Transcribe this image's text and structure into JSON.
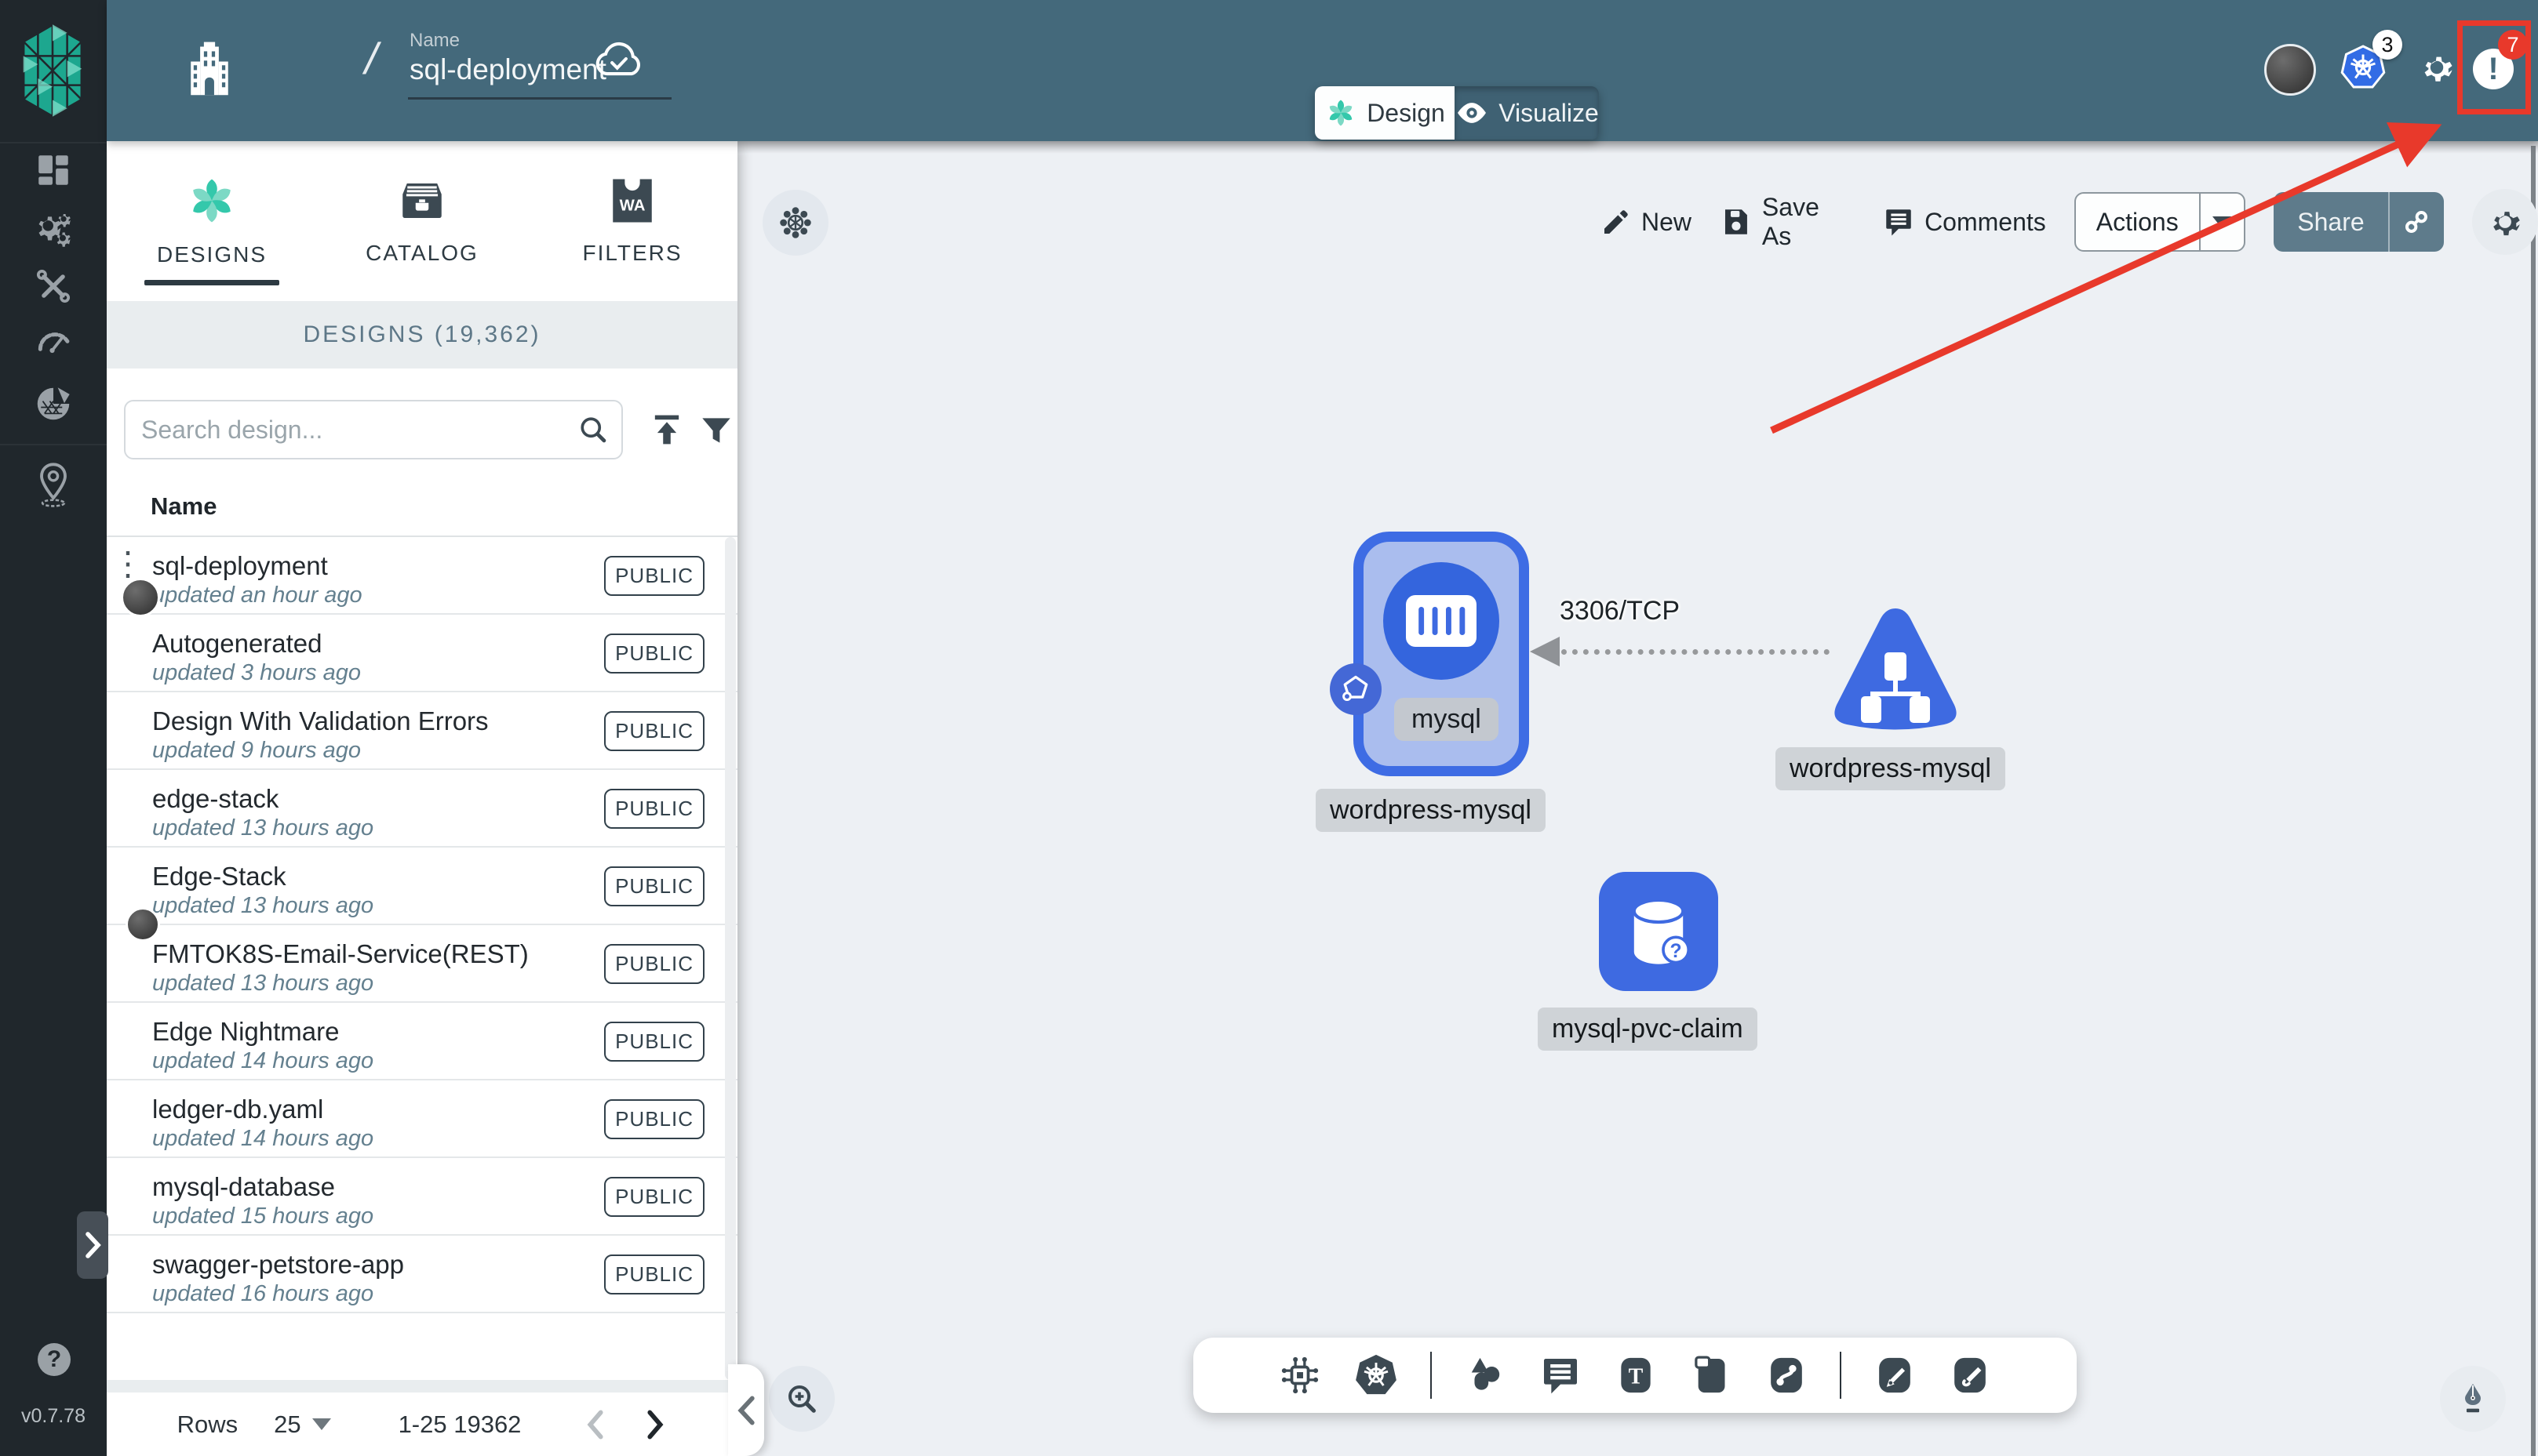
{
  "app": {
    "version": "v0.7.78",
    "help_glyph": "?",
    "notification_glyph": "!"
  },
  "header": {
    "name_label": "Name",
    "design_name": "sql-deployment",
    "breadcrumb_slash": "/",
    "kubernetes_context_count": "3",
    "notification_count": "7",
    "icons": [
      "organization-building-icon",
      "cloud-save-icon",
      "user-avatar",
      "kubernetes-icon",
      "gear-icon",
      "notification-icon"
    ]
  },
  "mode_tabs": {
    "design": "Design",
    "visualize": "Visualize"
  },
  "sidebar": {
    "icons": [
      "dashboard-icon",
      "lifecycle-gears-icon",
      "configuration-tools-icon",
      "performance-gauge-icon",
      "extensions-mesh-icon",
      "kanvas-pin-icon",
      "expand-chevron-icon",
      "help-icon"
    ]
  },
  "left_panel": {
    "tabs": [
      {
        "label": "DESIGNS"
      },
      {
        "label": "CATALOG"
      },
      {
        "label": "FILTERS"
      }
    ],
    "section_title": "DESIGNS (19,362)",
    "search_placeholder": "Search design...",
    "column_header": "Name",
    "rows": [
      {
        "name": "sql-deployment",
        "updated": "updated an hour ago",
        "visibility": "PUBLIC"
      },
      {
        "name": "Autogenerated",
        "updated": "updated 3 hours ago",
        "visibility": "PUBLIC"
      },
      {
        "name": "Design With Validation Errors",
        "updated": "updated 9 hours ago",
        "visibility": "PUBLIC"
      },
      {
        "name": "edge-stack",
        "updated": "updated 13 hours ago",
        "visibility": "PUBLIC"
      },
      {
        "name": "Edge-Stack",
        "updated": "updated 13 hours ago",
        "visibility": "PUBLIC"
      },
      {
        "name": "FMTOK8S-Email-Service(REST)",
        "updated": "updated 13 hours ago",
        "visibility": "PUBLIC"
      },
      {
        "name": "Edge Nightmare",
        "updated": "updated 14 hours ago",
        "visibility": "PUBLIC"
      },
      {
        "name": "ledger-db.yaml",
        "updated": "updated 14 hours ago",
        "visibility": "PUBLIC"
      },
      {
        "name": "mysql-database",
        "updated": "updated 15 hours ago",
        "visibility": "PUBLIC"
      },
      {
        "name": "swagger-petstore-app",
        "updated": "updated 16 hours ago",
        "visibility": "PUBLIC"
      }
    ],
    "pagination": {
      "rows_label": "Rows",
      "per_page": "25",
      "range": "1-25 19362"
    }
  },
  "canvas_toolbar": {
    "new": "New",
    "save_as": "Save As",
    "comments": "Comments",
    "actions": "Actions",
    "share": "Share"
  },
  "canvas": {
    "deployment_node": {
      "label": "mysql",
      "group_label": "wordpress-mysql"
    },
    "service_node": {
      "label": "wordpress-mysql"
    },
    "pvc_node": {
      "label": "mysql-pvc-claim",
      "badge_glyph": "?"
    },
    "edge_label": "3306/TCP",
    "bottom_toolbar_icons": [
      "circuit-component-icon",
      "kubernetes-wheel-icon",
      "shapes-icon",
      "comment-icon",
      "text-tool-icon",
      "note-tool-icon",
      "link-tool-icon",
      "draw-edge-tool-icon",
      "freehand-draw-tool-icon"
    ]
  },
  "colors": {
    "header_teal": "#44697b",
    "sidebar_dark": "#20272c",
    "accent_green": "#00b39f",
    "node_blue": "#3e6ae1",
    "node_fill": "#aabdee",
    "annotation_red": "#e8392b",
    "share_button": "#5e7b8b",
    "chip_gray": "#cfd3d7"
  }
}
